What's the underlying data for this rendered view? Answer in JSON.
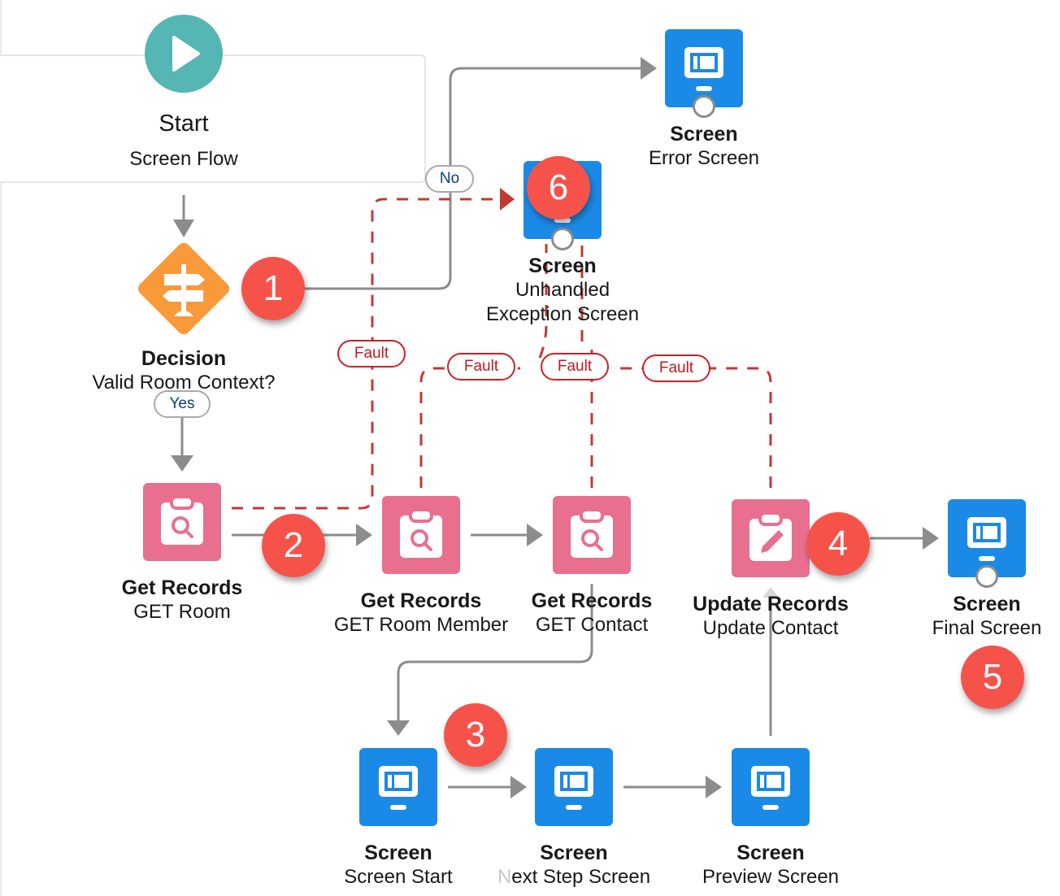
{
  "canvas": {
    "title": "Screen Flow builder canvas",
    "colors": {
      "start": "#55b6b4",
      "decision": "#f99a3a",
      "screen": "#1b8ae6",
      "record": "#e8708e",
      "badge": "#f5534a",
      "fault": "#c23934",
      "connector": "#8c8c8c",
      "path_label_text": "#0b3d7b"
    }
  },
  "start": {
    "icon": "play-icon",
    "title": "Start",
    "subtitle": "Screen Flow"
  },
  "nodes": {
    "decision": {
      "icon": "signpost-icon",
      "type": "Decision",
      "name": "Valid Room Context?"
    },
    "error_screen": {
      "icon": "screen-icon",
      "type": "Screen",
      "name": "Error Screen"
    },
    "unhandled_screen": {
      "icon": "screen-icon",
      "type": "Screen",
      "name_line1": "Unhandled",
      "name_line2": "Exception Screen"
    },
    "get_room": {
      "icon": "clipboard-search-icon",
      "type": "Get Records",
      "name": "GET Room"
    },
    "get_room_member": {
      "icon": "clipboard-search-icon",
      "type": "Get Records",
      "name": "GET Room Member"
    },
    "get_contact": {
      "icon": "clipboard-search-icon",
      "type": "Get Records",
      "name": "GET Contact"
    },
    "update_contact": {
      "icon": "clipboard-edit-icon",
      "type": "Update Records",
      "name": "Update Contact"
    },
    "final_screen": {
      "icon": "screen-icon",
      "type": "Screen",
      "name": "Final Screen"
    },
    "screen_start": {
      "icon": "screen-icon",
      "type": "Screen",
      "name": "Screen Start"
    },
    "next_step_screen": {
      "icon": "screen-icon",
      "type": "Screen",
      "name_first": "N",
      "name_rest": "ext Step Screen"
    },
    "preview_screen": {
      "icon": "screen-icon",
      "type": "Screen",
      "name": "Preview Screen"
    }
  },
  "path_labels": {
    "no": "No",
    "yes": "Yes",
    "fault": "Fault"
  },
  "badges": [
    "1",
    "2",
    "3",
    "4",
    "5",
    "6"
  ]
}
